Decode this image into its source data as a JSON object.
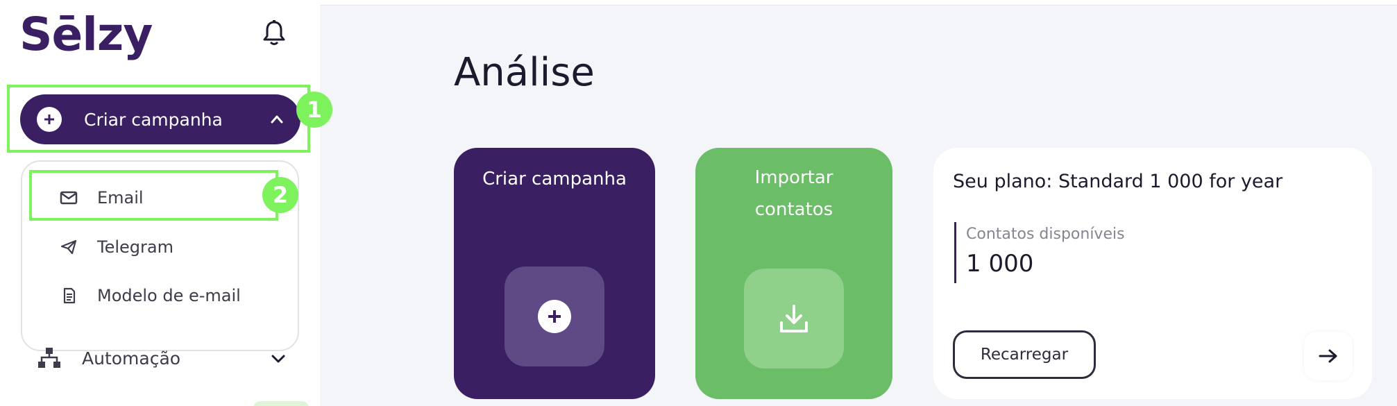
{
  "brand": {
    "logo_text": "Sēlzy",
    "accent": "#3a1f63",
    "highlight": "#7df25c"
  },
  "sidebar": {
    "create_button_label": "Criar campanha",
    "dropdown": [
      {
        "label": "Email",
        "icon": "envelope-icon"
      },
      {
        "label": "Telegram",
        "icon": "paper-plane-icon"
      },
      {
        "label": "Modelo de e-mail",
        "icon": "document-icon"
      }
    ],
    "automation_label": "Automação"
  },
  "annotations": {
    "badge_1": "1",
    "badge_2": "2"
  },
  "main": {
    "title": "Análise",
    "card_campaign_title": "Criar campanha",
    "card_import_title_line1": "Importar",
    "card_import_title_line2": "contatos",
    "plan": {
      "title": "Seu plano: Standard 1 000 for year",
      "contacts_label": "Contatos disponíveis",
      "contacts_value": "1 000",
      "recharge_label": "Recarregar"
    }
  }
}
